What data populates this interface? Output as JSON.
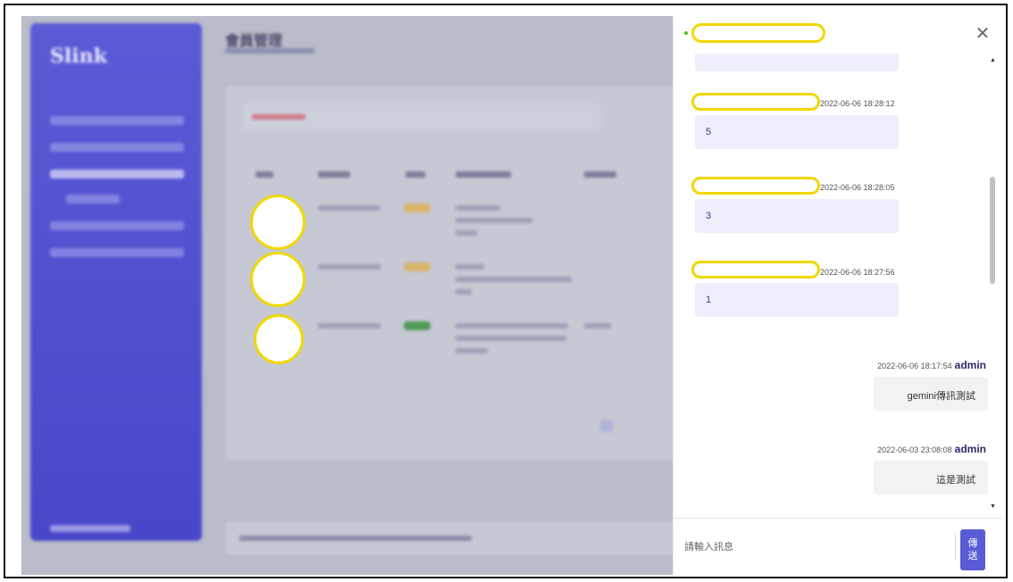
{
  "app": {
    "logo": "Slink",
    "accent_color": "#5b5bd6",
    "page_title": "會員管理"
  },
  "chat": {
    "status": "online",
    "status_color": "#52c41a",
    "close_icon": "close-icon",
    "messages": [
      {
        "direction": "in",
        "timestamp": "2022-06-06 18:28:12",
        "text": "5"
      },
      {
        "direction": "in",
        "timestamp": "2022-06-06 18:28:05",
        "text": "3"
      },
      {
        "direction": "in",
        "timestamp": "2022-06-06 18:27:56",
        "text": "1"
      },
      {
        "direction": "out",
        "timestamp": "2022-06-06 18:17:54",
        "sender": "admin",
        "text": "gemini傳訊測試"
      },
      {
        "direction": "out",
        "timestamp": "2022-06-03 23:08:08",
        "sender": "admin",
        "text": "這是測試"
      }
    ],
    "input": {
      "placeholder": "請輸入訊息",
      "value": ""
    },
    "send_label": "傳送"
  }
}
